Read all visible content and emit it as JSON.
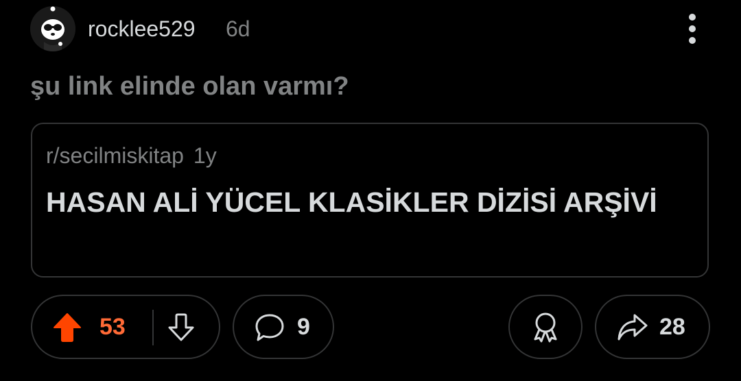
{
  "post": {
    "author": "rocklee529",
    "age": "6d",
    "title": "şu link elinde olan varmı?"
  },
  "crosspost": {
    "subreddit": "r/secilmiskitap",
    "age": "1y",
    "title": "HASAN ALİ YÜCEL KLASİKLER DİZİSİ ARŞİVİ"
  },
  "actions": {
    "upvotes": "53",
    "comments": "9",
    "shares": "28"
  },
  "icons": {
    "avatar": "panda-avatar-icon",
    "more": "more-vertical-icon",
    "upvote": "upvote-arrow-icon",
    "downvote": "downvote-arrow-icon",
    "comment": "comment-bubble-icon",
    "award": "award-icon",
    "share": "share-arrow-icon"
  },
  "colors": {
    "background": "#000000",
    "upvote_active": "#ff4500",
    "upvote_count": "#ff6a36",
    "text_primary": "#d7dadc",
    "text_muted": "#818384",
    "border": "#343536"
  }
}
